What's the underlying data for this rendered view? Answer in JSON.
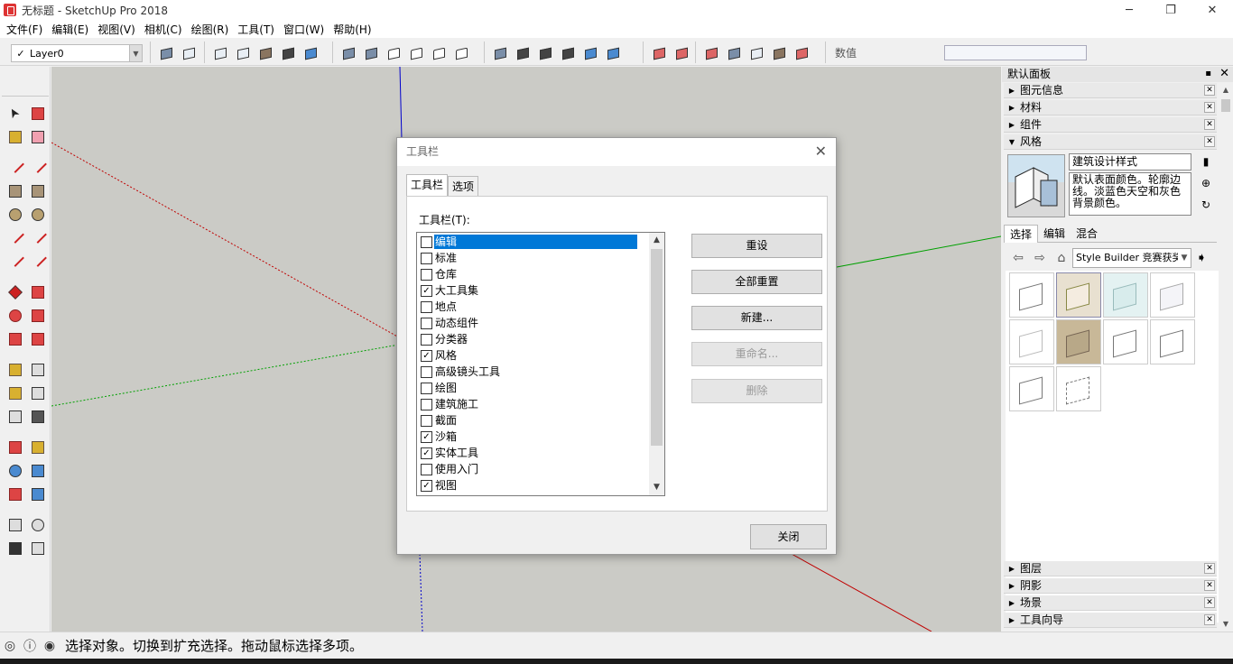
{
  "window": {
    "title": "无标题 - SketchUp Pro 2018",
    "minimize": "─",
    "maximize": "❐",
    "close": "✕"
  },
  "menu": [
    "文件(F)",
    "编辑(E)",
    "视图(V)",
    "相机(C)",
    "绘图(R)",
    "工具(T)",
    "窗口(W)",
    "帮助(H)"
  ],
  "toolbar": {
    "layer_check": "✓",
    "layer": "Layer0",
    "value_label": "数值"
  },
  "tray": {
    "title": "默认面板",
    "pin": "▪",
    "close": "✕",
    "sections_top": [
      {
        "label": "图元信息",
        "expanded": false
      },
      {
        "label": "材料",
        "expanded": false
      },
      {
        "label": "组件",
        "expanded": false
      },
      {
        "label": "风格",
        "expanded": true
      }
    ],
    "style": {
      "name": "建筑设计样式",
      "description": "默认表面颜色。轮廓边线。淡蓝色天空和灰色背景颜色。",
      "tabs": [
        "选择",
        "编辑",
        "混合"
      ],
      "active_tab": 0,
      "collection": "Style Builder 竞赛获奖"
    },
    "sections_bottom": [
      {
        "label": "图层"
      },
      {
        "label": "阴影"
      },
      {
        "label": "场景"
      },
      {
        "label": "工具向导"
      }
    ]
  },
  "status": {
    "text": "选择对象。切换到扩充选择。拖动鼠标选择多项。"
  },
  "dialog": {
    "title": "工具栏",
    "close_glyph": "✕",
    "tabs": [
      "工具栏",
      "选项"
    ],
    "active_tab": 0,
    "list_label": "工具栏(T):",
    "items": [
      {
        "label": "编辑",
        "checked": false,
        "selected": true
      },
      {
        "label": "标准",
        "checked": false
      },
      {
        "label": "仓库",
        "checked": false
      },
      {
        "label": "大工具集",
        "checked": true
      },
      {
        "label": "地点",
        "checked": false
      },
      {
        "label": "动态组件",
        "checked": false
      },
      {
        "label": "分类器",
        "checked": false
      },
      {
        "label": "风格",
        "checked": true
      },
      {
        "label": "高级镜头工具",
        "checked": false
      },
      {
        "label": "绘图",
        "checked": false
      },
      {
        "label": "建筑施工",
        "checked": false
      },
      {
        "label": "截面",
        "checked": false
      },
      {
        "label": "沙箱",
        "checked": true
      },
      {
        "label": "实体工具",
        "checked": true
      },
      {
        "label": "使用入门",
        "checked": false
      },
      {
        "label": "视图",
        "checked": true
      }
    ],
    "buttons": [
      {
        "label": "重设",
        "enabled": true
      },
      {
        "label": "全部重置",
        "enabled": true
      },
      {
        "label": "新建...",
        "enabled": true
      },
      {
        "label": "重命名...",
        "enabled": false
      },
      {
        "label": "删除",
        "enabled": false
      }
    ],
    "close_label": "关闭"
  },
  "colors": {
    "axis_red": "#c00000",
    "axis_green": "#00a000",
    "axis_blue": "#0000cc",
    "selection": "#0078d7",
    "viewport_bg": "#cbcbc6"
  }
}
